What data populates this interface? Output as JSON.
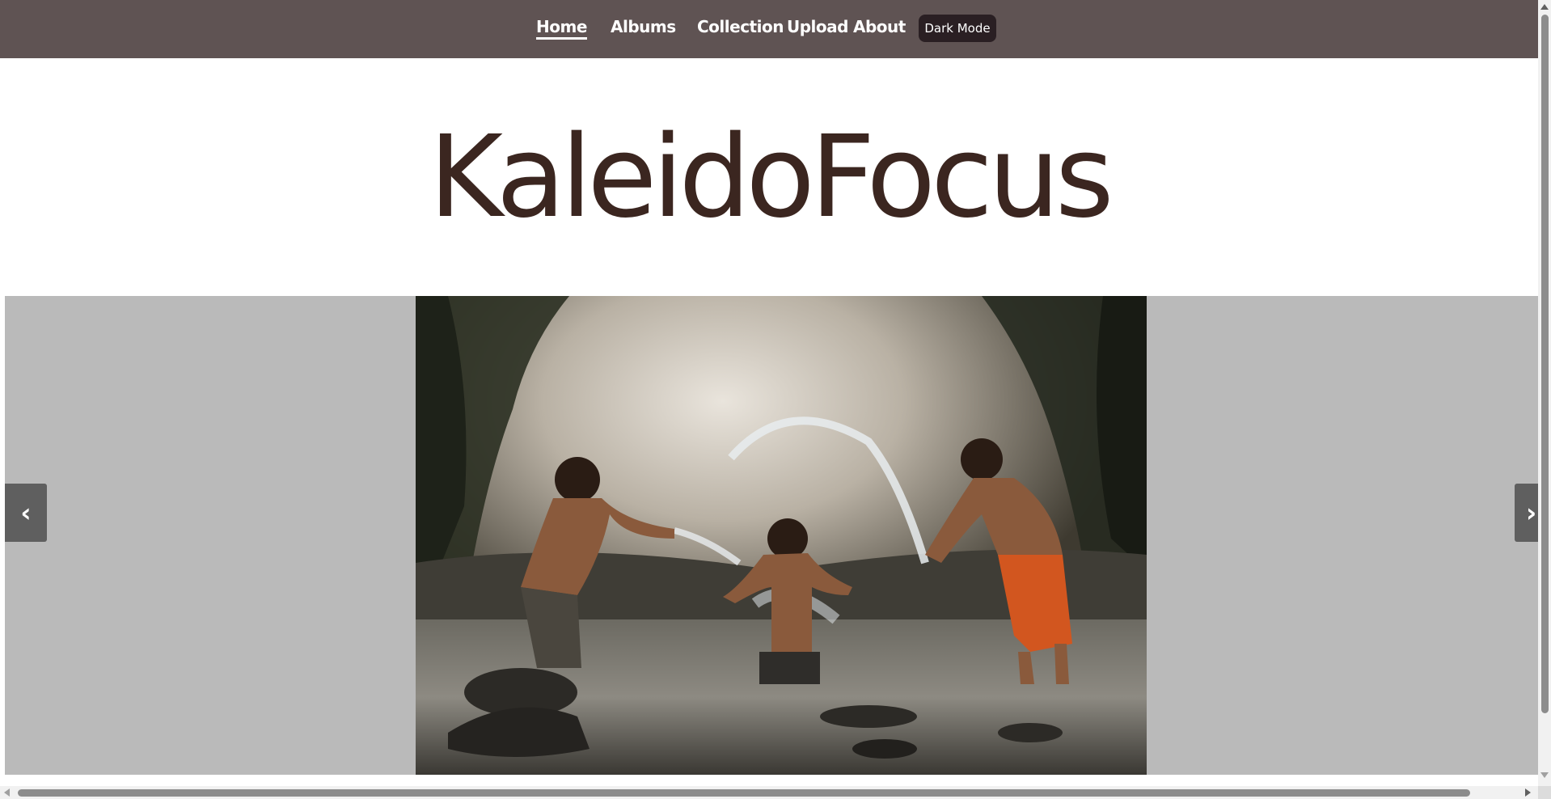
{
  "nav": {
    "links": [
      {
        "label": "Home",
        "active": true
      },
      {
        "label": "Albums",
        "active": false
      },
      {
        "label": "Collection",
        "active": false
      },
      {
        "label": "Upload",
        "active": false
      },
      {
        "label": "About",
        "active": false
      }
    ],
    "dark_mode_label": "Dark Mode"
  },
  "brand": {
    "title": "KaleidoFocus"
  },
  "slideshow": {
    "prev_label": "‹",
    "next_label": "›",
    "image_icon": "photo-children-splashing-river"
  },
  "colors": {
    "navbar_bg": "#5f5353",
    "brand_text": "#3b2620",
    "slideshow_bg": "#bababa",
    "dark_button_bg": "#2a1f23"
  }
}
